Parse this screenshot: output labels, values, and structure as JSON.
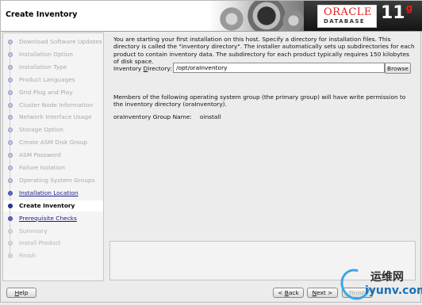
{
  "window": {
    "title": "Create Inventory"
  },
  "branding": {
    "oracle": "ORACLE",
    "database": "DATABASE",
    "version": "11",
    "version_suffix": "g",
    "oracle_red": "#e11f1f"
  },
  "sidebar": {
    "steps": [
      {
        "label": "Download Software Updates",
        "state": "done"
      },
      {
        "label": "Installation Option",
        "state": "done"
      },
      {
        "label": "Installation Type",
        "state": "done"
      },
      {
        "label": "Product Languages",
        "state": "done"
      },
      {
        "label": "Grid Plug and Play",
        "state": "done"
      },
      {
        "label": "Cluster Node Information",
        "state": "done"
      },
      {
        "label": "Network Interface Usage",
        "state": "done"
      },
      {
        "label": "Storage Option",
        "state": "done"
      },
      {
        "label": "Create ASM Disk Group",
        "state": "done"
      },
      {
        "label": "ASM Password",
        "state": "done"
      },
      {
        "label": "Failure Isolation",
        "state": "done"
      },
      {
        "label": "Operating System Groups",
        "state": "done"
      },
      {
        "label": "Installation Location",
        "state": "link"
      },
      {
        "label": "Create Inventory",
        "state": "current"
      },
      {
        "label": "Prerequisite Checks",
        "state": "link"
      },
      {
        "label": "Summary",
        "state": "pending"
      },
      {
        "label": "Install Product",
        "state": "pending"
      },
      {
        "label": "Finish",
        "state": "pending"
      }
    ]
  },
  "main": {
    "intro": "You are starting your first installation on this host. Specify a directory for installation files. This directory is called the \"inventory directory\". The installer automatically sets up subdirectories for each product to contain inventory data. The subdirectory for each product typically requires 150 kilobytes of disk space.",
    "inventory_label": "Inventory Directory:",
    "inventory_value": "/opt/oraInventory",
    "browse_label": "Browse",
    "members_text": "Members of the following operating system group (the primary group) will have write permission to the inventory directory (oraInventory).",
    "group_label": "oraInventory Group Name:",
    "group_value": "oinstall"
  },
  "footer": {
    "help_label": "Help",
    "back_label": "< Back",
    "next_label": "Next >",
    "finish_label": "Finish"
  },
  "watermark": {
    "top": "运维网",
    "bottom": "iyunv.com"
  }
}
